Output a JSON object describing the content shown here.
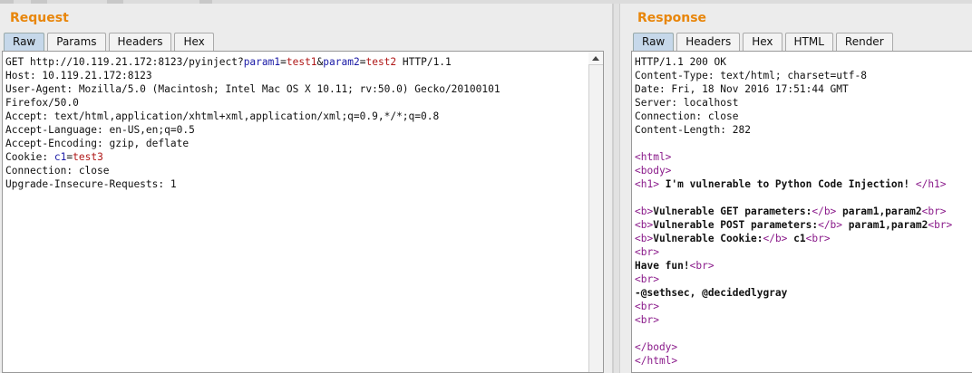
{
  "request": {
    "title": "Request",
    "tabs": [
      "Raw",
      "Params",
      "Headers",
      "Hex"
    ],
    "active_tab": "Raw",
    "lines": [
      [
        {
          "t": "GET http://10.119.21.172:8123/pyinject?"
        },
        {
          "t": "param1",
          "c": "pn"
        },
        {
          "t": "="
        },
        {
          "t": "test1",
          "c": "pv"
        },
        {
          "t": "&"
        },
        {
          "t": "param2",
          "c": "pn"
        },
        {
          "t": "="
        },
        {
          "t": "test2",
          "c": "pv"
        },
        {
          "t": " HTTP/1.1"
        }
      ],
      [
        {
          "t": "Host: 10.119.21.172:8123"
        }
      ],
      [
        {
          "t": "User-Agent: Mozilla/5.0 (Macintosh; Intel Mac OS X 10.11; rv:50.0) Gecko/20100101"
        }
      ],
      [
        {
          "t": "Firefox/50.0"
        }
      ],
      [
        {
          "t": "Accept: text/html,application/xhtml+xml,application/xml;q=0.9,*/*;q=0.8"
        }
      ],
      [
        {
          "t": "Accept-Language: en-US,en;q=0.5"
        }
      ],
      [
        {
          "t": "Accept-Encoding: gzip, deflate"
        }
      ],
      [
        {
          "t": "Cookie: "
        },
        {
          "t": "c1",
          "c": "pn"
        },
        {
          "t": "="
        },
        {
          "t": "test3",
          "c": "pv"
        }
      ],
      [
        {
          "t": "Connection: close"
        }
      ],
      [
        {
          "t": "Upgrade-Insecure-Requests: 1"
        }
      ]
    ]
  },
  "response": {
    "title": "Response",
    "tabs": [
      "Raw",
      "Headers",
      "Hex",
      "HTML",
      "Render"
    ],
    "active_tab": "Raw",
    "lines": [
      [
        {
          "t": "HTTP/1.1 200 OK"
        }
      ],
      [
        {
          "t": "Content-Type: text/html; charset=utf-8"
        }
      ],
      [
        {
          "t": "Date: Fri, 18 Nov 2016 17:51:44 GMT"
        }
      ],
      [
        {
          "t": "Server: localhost"
        }
      ],
      [
        {
          "t": "Connection: close"
        }
      ],
      [
        {
          "t": "Content-Length: 282"
        }
      ],
      [],
      [
        {
          "t": "<html>",
          "c": "tg"
        }
      ],
      [
        {
          "t": "<body>",
          "c": "tg"
        }
      ],
      [
        {
          "t": "<h1>",
          "c": "tg"
        },
        {
          "t": " I'm vulnerable to Python Code Injection! ",
          "c": "bd"
        },
        {
          "t": "</h1>",
          "c": "tg"
        }
      ],
      [],
      [
        {
          "t": "<b>",
          "c": "tg"
        },
        {
          "t": "Vulnerable GET parameters:",
          "c": "bd"
        },
        {
          "t": "</b>",
          "c": "tg"
        },
        {
          "t": " param1,param2",
          "c": "bd"
        },
        {
          "t": "<br>",
          "c": "tg"
        }
      ],
      [
        {
          "t": "<b>",
          "c": "tg"
        },
        {
          "t": "Vulnerable POST parameters:",
          "c": "bd"
        },
        {
          "t": "</b>",
          "c": "tg"
        },
        {
          "t": " param1,param2",
          "c": "bd"
        },
        {
          "t": "<br>",
          "c": "tg"
        }
      ],
      [
        {
          "t": "<b>",
          "c": "tg"
        },
        {
          "t": "Vulnerable Cookie:",
          "c": "bd"
        },
        {
          "t": "</b>",
          "c": "tg"
        },
        {
          "t": " c1",
          "c": "bd"
        },
        {
          "t": "<br>",
          "c": "tg"
        }
      ],
      [
        {
          "t": "<br>",
          "c": "tg"
        }
      ],
      [
        {
          "t": "Have fun!",
          "c": "bd"
        },
        {
          "t": "<br>",
          "c": "tg"
        }
      ],
      [
        {
          "t": "<br>",
          "c": "tg"
        }
      ],
      [
        {
          "t": "-@sethsec, @decidedlygray",
          "c": "bd"
        }
      ],
      [
        {
          "t": "<br>",
          "c": "tg"
        }
      ],
      [
        {
          "t": "<br>",
          "c": "tg"
        }
      ],
      [],
      [
        {
          "t": "</body>",
          "c": "tg"
        }
      ],
      [
        {
          "t": "</html>",
          "c": "tg"
        }
      ]
    ]
  }
}
